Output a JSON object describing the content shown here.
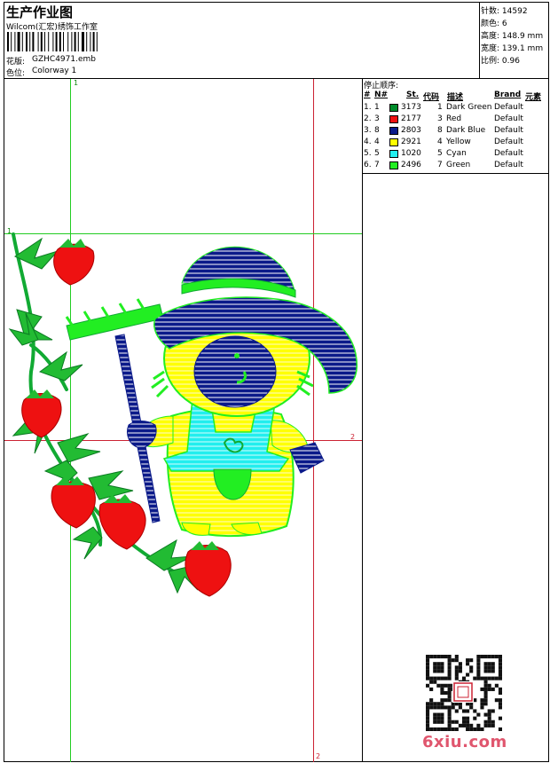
{
  "header": {
    "title": "生产作业图",
    "company": "Wilcom(汇宏)绣饰工作室",
    "file_label": "花版:",
    "file_value": "GZHC4971.emb",
    "colorway_label": "色位:",
    "colorway_value": "Colorway 1"
  },
  "stats": [
    {
      "label": "针数:",
      "value": "14592"
    },
    {
      "label": "颜色:",
      "value": "6"
    },
    {
      "label": "高度:",
      "value": "148.9 mm"
    },
    {
      "label": "宽度:",
      "value": "139.1 mm"
    },
    {
      "label": "比例:",
      "value": "0.96"
    }
  ],
  "stop_sequence": {
    "title": "停止顺序:",
    "headers": [
      "#",
      "N#",
      "St.",
      "代码",
      "描述",
      "Brand",
      "元素"
    ],
    "rows": [
      {
        "idx": "1.",
        "n": "1",
        "color": "#008c2b",
        "st": "3173",
        "code": "1",
        "desc": "Dark Green",
        "brand": "Default"
      },
      {
        "idx": "2.",
        "n": "3",
        "color": "#ee1111",
        "st": "2177",
        "code": "3",
        "desc": "Red",
        "brand": "Default"
      },
      {
        "idx": "3.",
        "n": "8",
        "color": "#0b1a8a",
        "st": "2803",
        "code": "8",
        "desc": "Dark Blue",
        "brand": "Default"
      },
      {
        "idx": "4.",
        "n": "4",
        "color": "#ffff00",
        "st": "2921",
        "code": "4",
        "desc": "Yellow",
        "brand": "Default"
      },
      {
        "idx": "5.",
        "n": "5",
        "color": "#22eeee",
        "st": "1020",
        "code": "5",
        "desc": "Cyan",
        "brand": "Default"
      },
      {
        "idx": "6.",
        "n": "7",
        "color": "#22ee22",
        "st": "2496",
        "code": "7",
        "desc": "Green",
        "brand": "Default"
      }
    ]
  },
  "canvas": {
    "axis_1_top": "1",
    "axis_1_left": "1",
    "axis_2_right": "2",
    "axis_2_bottom": "2"
  },
  "watermark": {
    "site": "6xiu.com",
    "qr_icon": "qr-code-icon",
    "seal_icon": "seal-icon"
  }
}
